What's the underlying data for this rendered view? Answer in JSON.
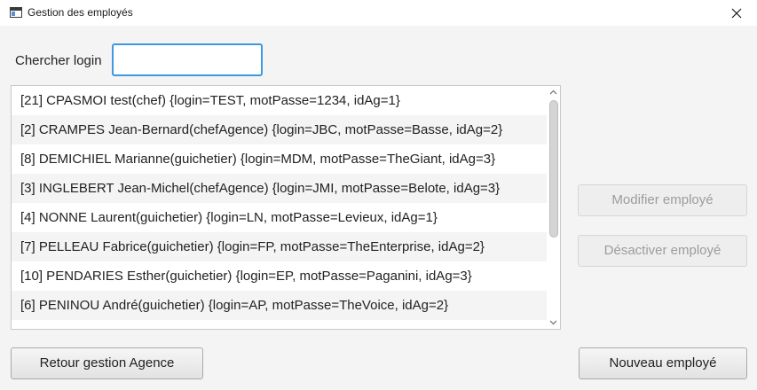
{
  "window": {
    "title": "Gestion des employés"
  },
  "search": {
    "label": "Chercher login",
    "value": "",
    "placeholder": ""
  },
  "employees": [
    "[21]  CPASMOI test(chef)  {login=TEST, motPasse=1234, idAg=1}",
    "[2]  CRAMPES Jean-Bernard(chefAgence)  {login=JBC, motPasse=Basse, idAg=2}",
    "[8]  DEMICHIEL Marianne(guichetier)  {login=MDM, motPasse=TheGiant, idAg=3}",
    "[3]  INGLEBERT Jean-Michel(chefAgence)  {login=JMI, motPasse=Belote, idAg=3}",
    "[4]  NONNE Laurent(guichetier)  {login=LN, motPasse=Levieux, idAg=1}",
    "[7]  PELLEAU Fabrice(guichetier)  {login=FP, motPasse=TheEnterprise, idAg=2}",
    "[10]  PENDARIES Esther(guichetier)  {login=EP, motPasse=Paganini, idAg=3}",
    "[6]  PENINOU André(guichetier)  {login=AP, motPasse=TheVoice, idAg=2}"
  ],
  "buttons": {
    "modify": "Modifier employé",
    "deactivate": "Désactiver employé",
    "back": "Retour gestion Agence",
    "new": "Nouveau employé"
  },
  "icons": {
    "app": "app-window-icon",
    "close": "close-icon",
    "scroll_up": "chevron-up-icon",
    "scroll_down": "chevron-down-icon"
  },
  "colors": {
    "focus_border": "#3d9ae0",
    "row_alt": "#f4f4f4",
    "disabled_text": "#9c9c9c"
  }
}
